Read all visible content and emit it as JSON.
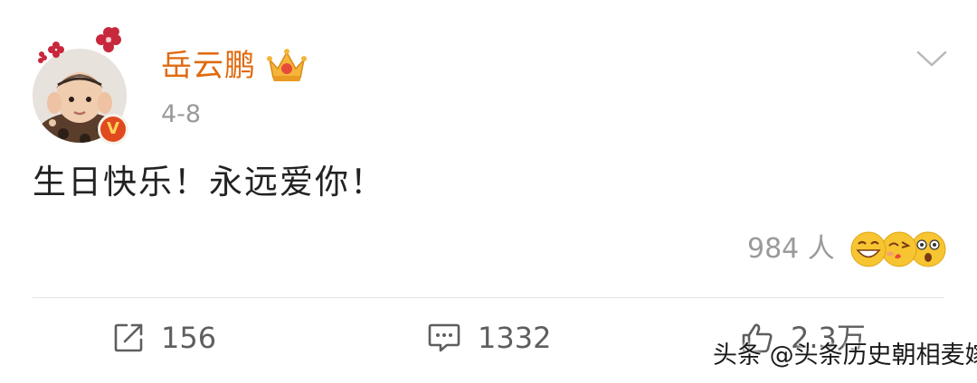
{
  "post": {
    "username": "岳云鹏",
    "date": "4-8",
    "text": "生日快乐！永远爱你！",
    "reactions": {
      "count_label": "984 人",
      "emojis": [
        "grinning-face-icon",
        "kissing-face-icon",
        "astonished-face-icon"
      ]
    }
  },
  "actions": {
    "repost": {
      "icon": "repost-icon",
      "count": "156"
    },
    "comment": {
      "icon": "comment-icon",
      "count": "1332"
    },
    "like": {
      "icon": "thumbs-up-icon",
      "count": "2.3万"
    }
  },
  "watermark": "头条 @头条历史朝相麦嫁",
  "colors": {
    "username": "#e06a0f",
    "meta_gray": "#9a9a9a",
    "text": "#222222",
    "action_gray": "#5e5e5e",
    "verified_badge": "#e04a1e"
  }
}
